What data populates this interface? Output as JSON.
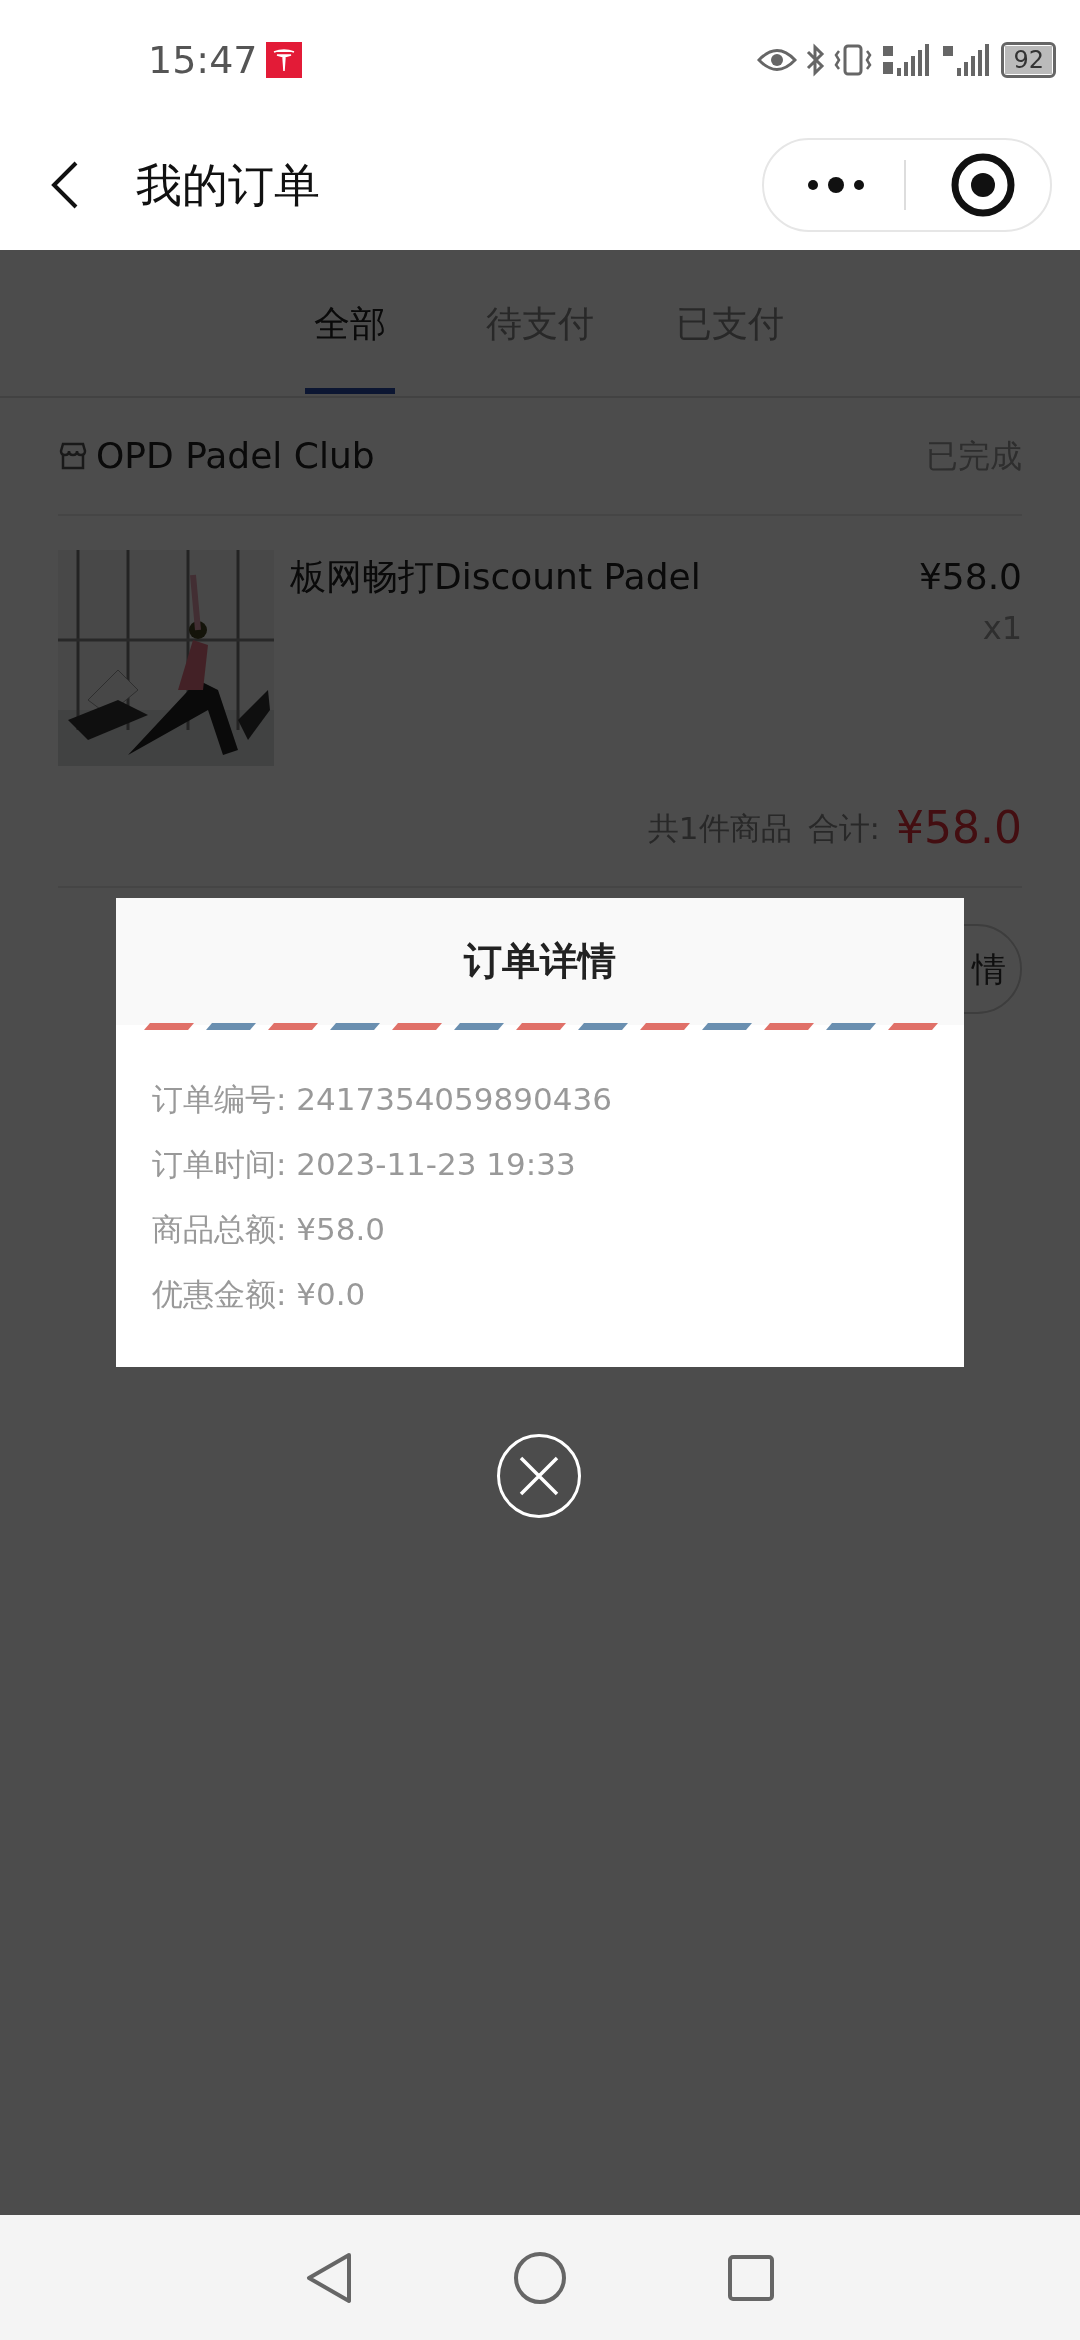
{
  "status_bar": {
    "time": "15:47",
    "battery": "92"
  },
  "header": {
    "title": "我的订单"
  },
  "tabs": [
    {
      "label": "全部",
      "selected": true
    },
    {
      "label": "待支付",
      "selected": false
    },
    {
      "label": "已支付",
      "selected": false
    }
  ],
  "order": {
    "shop": "OPD Padel Club",
    "status": "已完成",
    "items": [
      {
        "kind": "picture",
        "name": "板网畅打Discount Padel",
        "price": "¥58.0",
        "quantity": "x1"
      }
    ],
    "summary": "共1件商品",
    "total_label": "合计:",
    "total": "¥58.0",
    "button": "情"
  },
  "modal": {
    "title": "订单详情",
    "lines": [
      "订单编号: 2417354059890436",
      "订单时间: 2023-11-23 19:33",
      "商品总额: ¥58.0",
      "优惠金额: ¥0.0"
    ]
  }
}
